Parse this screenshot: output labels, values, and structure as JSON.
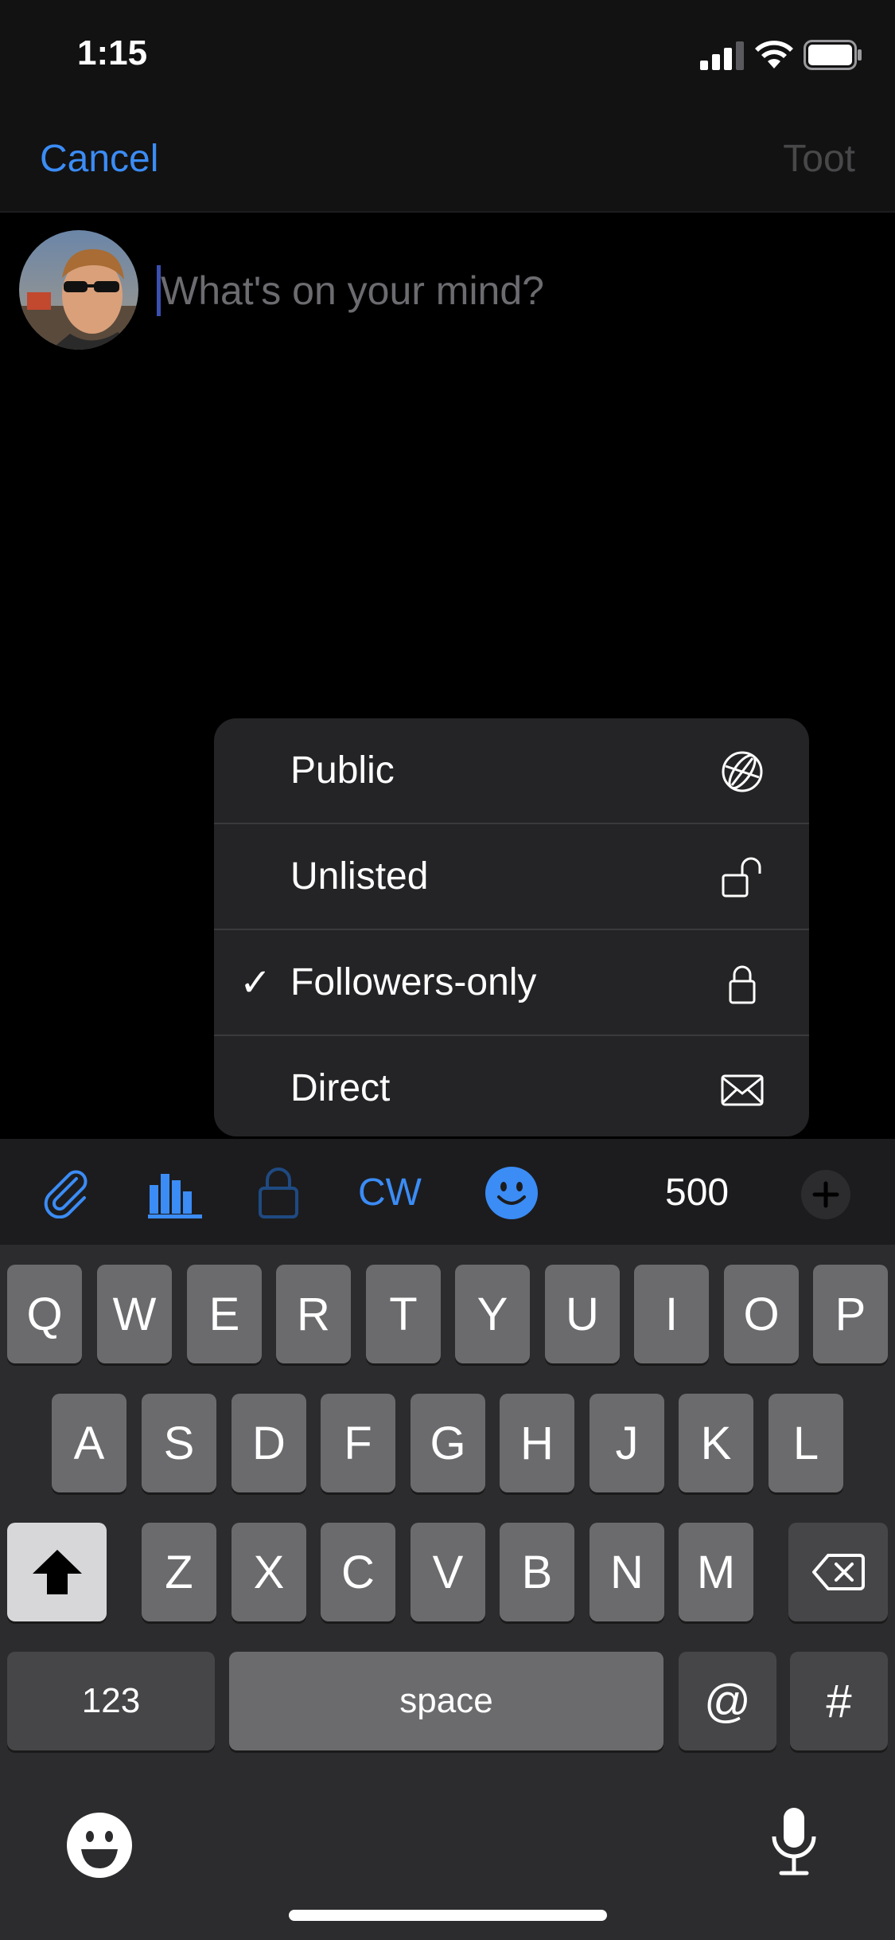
{
  "status_bar": {
    "time": "1:15"
  },
  "nav": {
    "cancel_label": "Cancel",
    "toot_label": "Toot"
  },
  "compose": {
    "placeholder": "What's on your mind?"
  },
  "visibility_menu": {
    "items": [
      {
        "label": "Public",
        "icon": "globe-icon",
        "checked": false
      },
      {
        "label": "Unlisted",
        "icon": "unlocked-icon",
        "checked": false
      },
      {
        "label": "Followers-only",
        "icon": "lock-icon",
        "checked": true
      },
      {
        "label": "Direct",
        "icon": "envelope-icon",
        "checked": false
      }
    ],
    "check_mark": "✓"
  },
  "toolbar": {
    "cw_label": "CW",
    "char_count": "500",
    "icons": [
      "paperclip-icon",
      "poll-icon",
      "lock-icon",
      "emoji-icon",
      "add-icon"
    ]
  },
  "keyboard": {
    "row1": [
      "Q",
      "W",
      "E",
      "R",
      "T",
      "Y",
      "U",
      "I",
      "O",
      "P"
    ],
    "row2": [
      "A",
      "S",
      "D",
      "F",
      "G",
      "H",
      "J",
      "K",
      "L"
    ],
    "row3": [
      "Z",
      "X",
      "C",
      "V",
      "B",
      "N",
      "M"
    ],
    "numbers_label": "123",
    "space_label": "space",
    "at_label": "@",
    "hash_label": "#",
    "icons": [
      "shift-icon",
      "delete-icon",
      "emoji-keyboard-icon",
      "microphone-icon"
    ]
  },
  "colors": {
    "accent": "#3b8cf5",
    "background": "#000000",
    "toolbar": "#1c1c1e",
    "keyboard": "#2c2c2e"
  }
}
